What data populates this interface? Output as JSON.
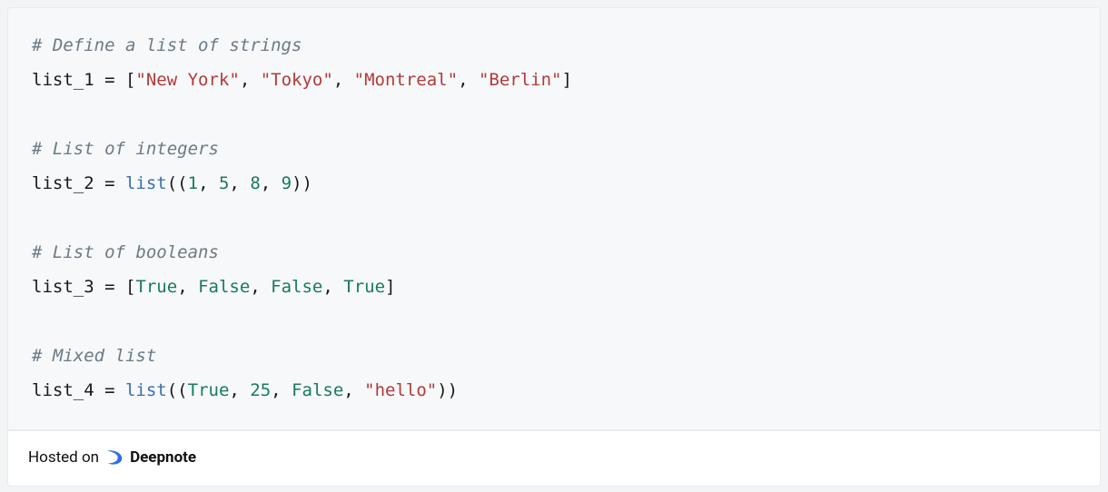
{
  "code": {
    "lines": [
      {
        "tokens": [
          {
            "t": "# Define a list of strings",
            "c": "comment"
          }
        ]
      },
      {
        "tokens": [
          {
            "t": "list_1 ",
            "c": "ident"
          },
          {
            "t": "= ",
            "c": "op"
          },
          {
            "t": "[",
            "c": "punct"
          },
          {
            "t": "\"New York\"",
            "c": "string"
          },
          {
            "t": ", ",
            "c": "punct"
          },
          {
            "t": "\"Tokyo\"",
            "c": "string"
          },
          {
            "t": ", ",
            "c": "punct"
          },
          {
            "t": "\"Montreal\"",
            "c": "string"
          },
          {
            "t": ", ",
            "c": "punct"
          },
          {
            "t": "\"Berlin\"",
            "c": "string"
          },
          {
            "t": "]",
            "c": "punct"
          }
        ]
      },
      {
        "tokens": []
      },
      {
        "tokens": [
          {
            "t": "# List of integers",
            "c": "comment"
          }
        ]
      },
      {
        "tokens": [
          {
            "t": "list_2 ",
            "c": "ident"
          },
          {
            "t": "= ",
            "c": "op"
          },
          {
            "t": "list",
            "c": "func"
          },
          {
            "t": "((",
            "c": "punct"
          },
          {
            "t": "1",
            "c": "number"
          },
          {
            "t": ", ",
            "c": "punct"
          },
          {
            "t": "5",
            "c": "number"
          },
          {
            "t": ", ",
            "c": "punct"
          },
          {
            "t": "8",
            "c": "number"
          },
          {
            "t": ", ",
            "c": "punct"
          },
          {
            "t": "9",
            "c": "number"
          },
          {
            "t": "))",
            "c": "punct"
          }
        ]
      },
      {
        "tokens": []
      },
      {
        "tokens": [
          {
            "t": "# List of booleans",
            "c": "comment"
          }
        ]
      },
      {
        "tokens": [
          {
            "t": "list_3 ",
            "c": "ident"
          },
          {
            "t": "= ",
            "c": "op"
          },
          {
            "t": "[",
            "c": "punct"
          },
          {
            "t": "True",
            "c": "builtin"
          },
          {
            "t": ", ",
            "c": "punct"
          },
          {
            "t": "False",
            "c": "builtin"
          },
          {
            "t": ", ",
            "c": "punct"
          },
          {
            "t": "False",
            "c": "builtin"
          },
          {
            "t": ", ",
            "c": "punct"
          },
          {
            "t": "True",
            "c": "builtin"
          },
          {
            "t": "]",
            "c": "punct"
          }
        ]
      },
      {
        "tokens": []
      },
      {
        "tokens": [
          {
            "t": "# Mixed list",
            "c": "comment"
          }
        ]
      },
      {
        "tokens": [
          {
            "t": "list_4 ",
            "c": "ident"
          },
          {
            "t": "= ",
            "c": "op"
          },
          {
            "t": "list",
            "c": "func"
          },
          {
            "t": "((",
            "c": "punct"
          },
          {
            "t": "True",
            "c": "builtin"
          },
          {
            "t": ", ",
            "c": "punct"
          },
          {
            "t": "25",
            "c": "number"
          },
          {
            "t": ", ",
            "c": "punct"
          },
          {
            "t": "False",
            "c": "builtin"
          },
          {
            "t": ", ",
            "c": "punct"
          },
          {
            "t": "\"hello\"",
            "c": "string"
          },
          {
            "t": "))",
            "c": "punct"
          }
        ]
      }
    ]
  },
  "footer": {
    "hosted_on": "Hosted on",
    "brand": "Deepnote"
  }
}
